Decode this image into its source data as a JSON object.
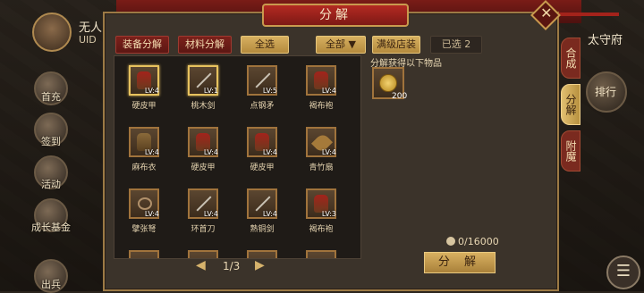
{
  "hud": {
    "player_name": "无人",
    "uid_label": "UID",
    "right_title": "太守府",
    "rank_label": "排行",
    "left_buttons": [
      "首充",
      "签到",
      "活动",
      "成长基金",
      "出兵"
    ]
  },
  "panel": {
    "title": "分解",
    "close_icon": "close-icon"
  },
  "toolbar": {
    "equip_decompose": "装备分解",
    "material_decompose": "材料分解",
    "select_all": "全选",
    "filter_label": "全部",
    "full_level_label": "满级店装",
    "selected_text": "已选 2"
  },
  "items": [
    {
      "name": "硬皮甲",
      "lv": "LV:4",
      "icon": "armor-icon",
      "selected": true
    },
    {
      "name": "桃木剑",
      "lv": "LV:1",
      "icon": "sword-icon",
      "selected": true
    },
    {
      "name": "点钢矛",
      "lv": "LV:5",
      "icon": "spear-icon",
      "selected": false
    },
    {
      "name": "褐布袍",
      "lv": "LV:4",
      "icon": "robe-icon",
      "selected": false
    },
    {
      "name": "麻布衣",
      "lv": "LV:4",
      "icon": "cloth-icon",
      "selected": false
    },
    {
      "name": "硬皮甲",
      "lv": "LV:4",
      "icon": "armor-icon",
      "selected": false
    },
    {
      "name": "硬皮甲",
      "lv": "LV:4",
      "icon": "armor-icon",
      "selected": false
    },
    {
      "name": "青竹扇",
      "lv": "LV:4",
      "icon": "fan-icon",
      "selected": false
    },
    {
      "name": "擘张弩",
      "lv": "LV:4",
      "icon": "crossbow-icon",
      "selected": false
    },
    {
      "name": "环首刀",
      "lv": "LV:4",
      "icon": "blade-icon",
      "selected": false
    },
    {
      "name": "熟铜剑",
      "lv": "LV:4",
      "icon": "sword-icon",
      "selected": false
    },
    {
      "name": "褐布袍",
      "lv": "LV:3",
      "icon": "robe-icon",
      "selected": false
    }
  ],
  "pager": {
    "text": "1/3"
  },
  "result": {
    "label": "分解获得以下物品",
    "coin_amount": "200",
    "capacity": "0/16000",
    "decompose_button": "分 解"
  },
  "side_tabs": [
    {
      "label": "合成",
      "active": false
    },
    {
      "label": "分解",
      "active": true
    },
    {
      "label": "附魔",
      "active": false
    }
  ]
}
